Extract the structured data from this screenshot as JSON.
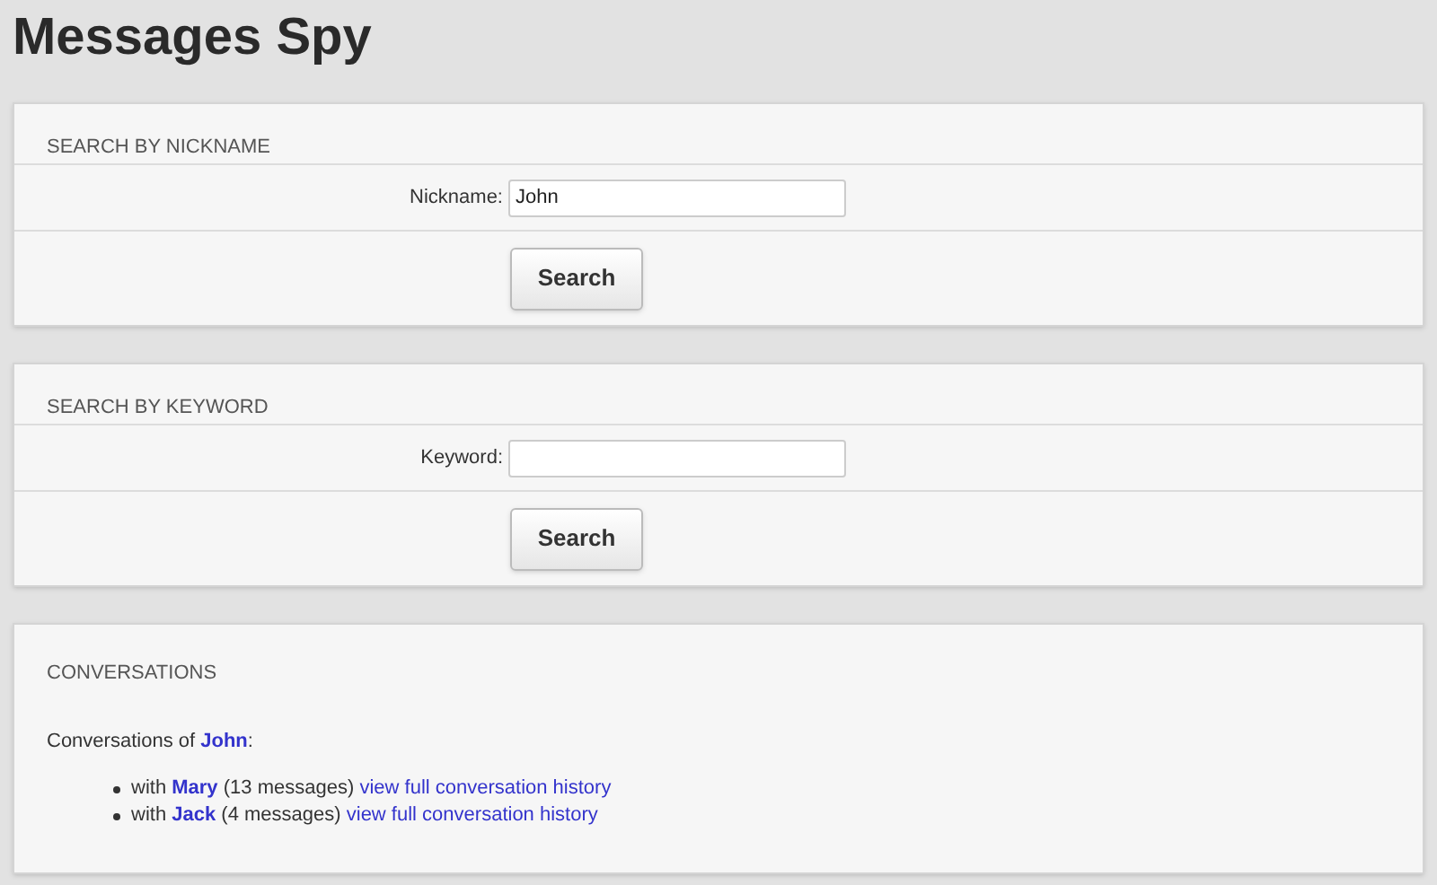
{
  "title": "Messages Spy",
  "search_forms": [
    {
      "heading": "SEARCH BY NICKNAME",
      "label": "Nickname:",
      "value": "John",
      "button": "Search"
    },
    {
      "heading": "SEARCH BY KEYWORD",
      "label": "Keyword:",
      "button": "Search"
    }
  ],
  "conversations": {
    "heading": "CONVERSATIONS",
    "intro": {
      "prefix": "Conversations of",
      "name": "John",
      "suffix": ":"
    },
    "items": [
      {
        "prefix": "with",
        "name": "Mary",
        "count": "(13 messages)",
        "link": "view full conversation history"
      },
      {
        "prefix": "with",
        "name": "Jack",
        "count": "(4 messages)",
        "link": "view full conversation history"
      }
    ]
  }
}
